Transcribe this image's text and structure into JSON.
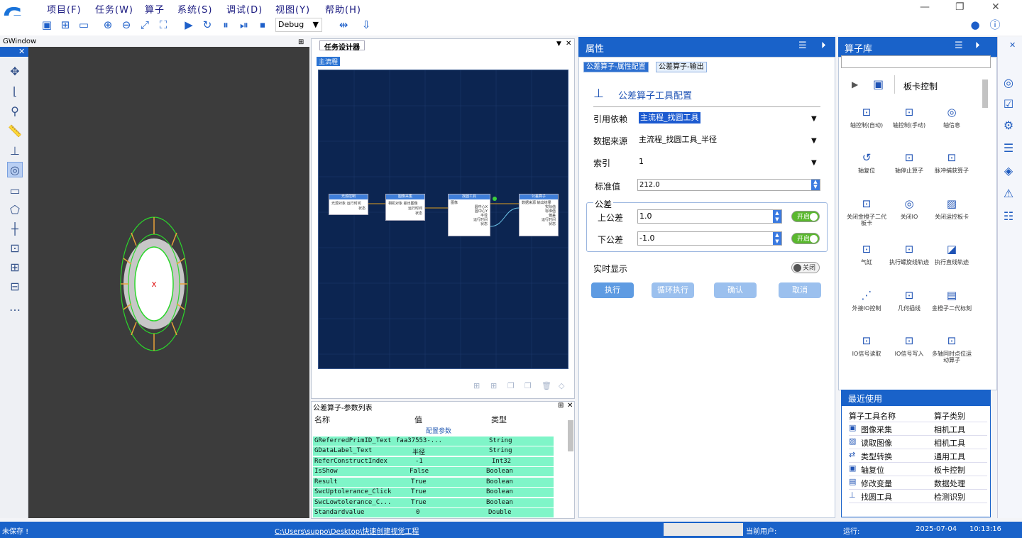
{
  "app": {
    "logo": "G"
  },
  "menu": [
    "项目(F)",
    "任务(W)",
    "算子",
    "系统(S)",
    "调试(D)",
    "视图(Y)",
    "帮助(H)"
  ],
  "toolbar": {
    "debug_value": "Debug"
  },
  "gwindow": {
    "title": "GWindow",
    "close": "✕",
    "pin": "⊞",
    "mark": "x"
  },
  "design": {
    "tab": "任务设计器",
    "flow_tab": "主流程",
    "nodes": [
      {
        "title": "光源控制",
        "rows": [
          "光源对象",
          "运行时间",
          "状态"
        ]
      },
      {
        "title": "图像采集",
        "rows": [
          "相机对象",
          "输出图像",
          "运行时间",
          "状态"
        ]
      },
      {
        "title": "找圆工具",
        "rows": [
          "图像",
          "圆中心X",
          "圆中心Y",
          "半径",
          "运行时间",
          "状态"
        ]
      },
      {
        "title": "公差算子",
        "rows": [
          "数据来源",
          "输出结果",
          "实际值",
          "标准值",
          "偏差",
          "运行时间",
          "状态"
        ]
      }
    ]
  },
  "params": {
    "title": "公差算子-参数列表",
    "headers": [
      "名称",
      "值",
      "类型"
    ],
    "group": "配置参数",
    "rows": [
      [
        "GReferredPrimID_Text",
        "faa37553-...",
        "String"
      ],
      [
        "GDataLabel_Text",
        "半径",
        "String"
      ],
      [
        "ReferConstructIndex",
        "-1",
        "Int32"
      ],
      [
        "IsShow",
        "False",
        "Boolean"
      ],
      [
        "Result",
        "True",
        "Boolean"
      ],
      [
        "SwcUptolerance_Click",
        "True",
        "Boolean"
      ],
      [
        "SwcLowtolerance_C...",
        "True",
        "Boolean"
      ],
      [
        "Standardvalue",
        "0",
        "Double"
      ]
    ]
  },
  "props": {
    "title": "属性",
    "tab1": "公差算子-属性配置",
    "tab2": "公差算子-输出",
    "config_title": "公差算子工具配置",
    "ref_label": "引用依赖",
    "ref_value": "主流程_找圆工具",
    "src_label": "数据来源",
    "src_value": "主流程_找圆工具_半径",
    "idx_label": "索引",
    "idx_value": "1",
    "std_label": "标准值",
    "std_value": "212.0",
    "tol_group": "公差",
    "up_label": "上公差",
    "up_value": "1.0",
    "low_label": "下公差",
    "low_value": "-1.0",
    "on": "开启",
    "off": "关闭",
    "realtime_label": "实时显示",
    "btn_run": "执行",
    "btn_loop": "循环执行",
    "btn_ok": "确认",
    "btn_cancel": "取消"
  },
  "lib": {
    "title": "算子库",
    "category": "板卡控制",
    "ops": [
      "轴控制(自动)",
      "轴控制(手动)",
      "轴信息",
      "轴复位",
      "轴停止算子",
      "脉冲捕获算子",
      "关闭金橙子二代板卡",
      "关闭IO",
      "关闭运控板卡",
      "气缸",
      "执行螺旋线轨迹",
      "执行直线轨迹",
      "外接IO控制",
      "几何插线",
      "金橙子二代标刻",
      "IO信号读取",
      "IO信号写入",
      "多轴同时点位运动算子"
    ]
  },
  "recent": {
    "title": "最近使用",
    "col1": "算子工具名称",
    "col2": "算子类别",
    "rows": [
      [
        "图像采集",
        "相机工具"
      ],
      [
        "读取图像",
        "相机工具"
      ],
      [
        "类型转换",
        "通用工具"
      ],
      [
        "轴复位",
        "板卡控制"
      ],
      [
        "修改变量",
        "数据处理"
      ],
      [
        "找圆工具",
        "检测识别"
      ]
    ]
  },
  "status": {
    "saved": "未保存 !",
    "path": "C:\\Users\\suppo\\Desktop\\快速创建视觉工程",
    "user": "当前用户:",
    "run": "运行:",
    "date": "2025-07-04",
    "time": "10:13:16"
  }
}
